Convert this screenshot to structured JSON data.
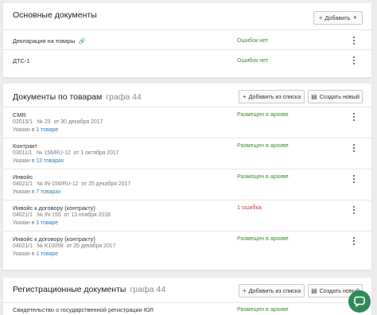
{
  "colors": {
    "accent_green": "#3f8f2e",
    "error_red": "#d93b3b",
    "link_blue": "#2f7bbf",
    "fab_green": "#2e8b57"
  },
  "main_docs": {
    "title": "Основные документы",
    "add_button": "Добавить",
    "rows": [
      {
        "name": "Декларация на товары",
        "status": "Ошибок нет",
        "attachment_icon": "paperclip-icon"
      },
      {
        "name": "ДТС-1",
        "status": "Ошибок нет"
      }
    ]
  },
  "goods_docs": {
    "title": "Документы по товарам",
    "subtitle": "графа 44",
    "add_from_list": "Добавить из списка",
    "create_new": "Создать новый",
    "rows": [
      {
        "name": "CMR",
        "code": "02015/1",
        "num": "№ 23",
        "date": "от 30 декабря 2017",
        "ref_prefix": "Указан в",
        "ref_link": "1 товаре",
        "status": "Размещен в архиве",
        "status_type": "ok"
      },
      {
        "name": "Контракт",
        "code": "03011/1",
        "num": "№ 156/RU-12",
        "date": "от 1 октября 2017",
        "ref_prefix": "Указан в",
        "ref_link": "13 товарах",
        "status": "Размещен в архиве",
        "status_type": "ok"
      },
      {
        "name": "Инвойс",
        "code": "04021/1",
        "num": "№ IN-156/RU-12",
        "date": "от 25 декабря 2017",
        "ref_prefix": "Указан в",
        "ref_link": "7 товарах",
        "status": "Размещен в архиве",
        "status_type": "ok"
      },
      {
        "name": "Инвойс к договору (контракту)",
        "code": "04021/1",
        "num": "№ IN-155",
        "date": "от 13 ноября 2018",
        "ref_prefix": "Указан в",
        "ref_link": "1 товаре",
        "status": "1 ошибка",
        "status_type": "error"
      },
      {
        "name": "Инвойс к договору (контракту)",
        "code": "04021/1",
        "num": "№ K10058",
        "date": "от 25 декабря 2017",
        "ref_prefix": "Указан в",
        "ref_link": "1 товаре",
        "status": "Размещен в архиве",
        "status_type": "ok"
      }
    ]
  },
  "reg_docs": {
    "title": "Регистрационные документы",
    "subtitle": "графа 44",
    "add_from_list": "Добавить из списка",
    "create_new": "Создать новый",
    "rows": [
      {
        "name": "Свидетельство о государственной регистрации ЮЛ",
        "status": "Размещен в архиве"
      }
    ]
  }
}
